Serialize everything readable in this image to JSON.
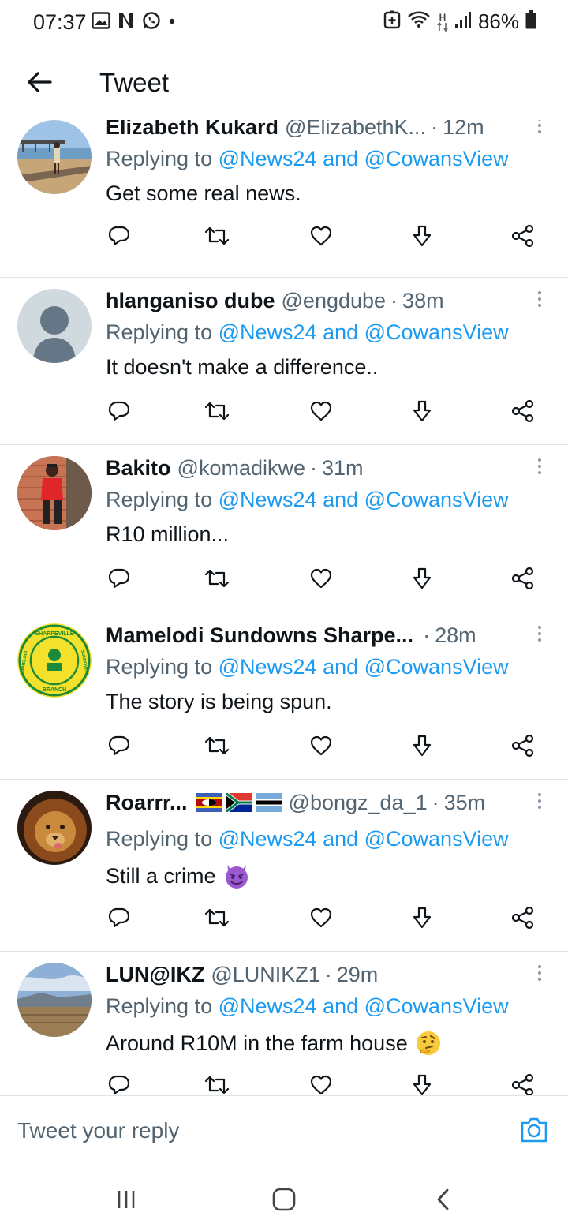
{
  "status_bar": {
    "time": "07:37",
    "battery_percent": "86%",
    "network_label": "H",
    "left_icons": [
      "gallery-icon",
      "netflix-icon",
      "whatsapp-icon",
      "dot-icon"
    ],
    "right_icons": [
      "battery-saver-icon",
      "wifi-icon",
      "data-arrows-icon",
      "signal-icon",
      "battery-icon"
    ]
  },
  "header": {
    "title": "Tweet"
  },
  "tweets": [
    {
      "name": "Elizabeth Kukard",
      "handle": "@ElizabethK...",
      "time": "12m",
      "replying_prefix": "Replying to",
      "replying_to": "@News24 and @CowansView",
      "text": "Get some real news.",
      "avatar": "beach-pier-photo"
    },
    {
      "name": "hlanganiso dube",
      "handle": "@engdube",
      "time": "38m",
      "replying_prefix": "Replying to",
      "replying_to": "@News24 and @CowansView",
      "text": "It doesn't make a difference..",
      "avatar": "default-profile"
    },
    {
      "name": "Bakito",
      "handle": "@komadikwe",
      "time": "31m",
      "replying_prefix": "Replying to",
      "replying_to": "@News24 and @CowansView",
      "text": "R10 million...",
      "avatar": "person-red-shirt-photo"
    },
    {
      "name": "Mamelodi Sundowns Sharpe...",
      "handle": "",
      "time": "28m",
      "replying_prefix": "Replying to",
      "replying_to": "@News24 and @CowansView",
      "text": "The story is being spun.",
      "avatar": "sundowns-badge",
      "avatar_text": {
        "top": "SHARPEVILLE",
        "left": "MAMELODI",
        "right": "SUNDOWNS",
        "bottom": "BRANCH"
      }
    },
    {
      "name": "Roarrr...",
      "handle": "@bongz_da_1",
      "time": "35m",
      "replying_prefix": "Replying to",
      "replying_to": "@News24 and @CowansView",
      "text": "Still a crime",
      "text_emoji": "smiling-devil-emoji",
      "name_flags": [
        "eswatini-flag",
        "south-africa-flag",
        "botswana-flag"
      ],
      "avatar": "lion-photo"
    },
    {
      "name": "LUN@IKZ",
      "handle": "@LUNIKZ1",
      "time": "29m",
      "replying_prefix": "Replying to",
      "replying_to": "@News24 and @CowansView",
      "text": "Around R10M in the farm house",
      "text_emoji": "thinking-face-emoji",
      "avatar": "landscape-photo"
    }
  ],
  "reply_box": {
    "placeholder": "Tweet your reply"
  },
  "colors": {
    "link": "#1d9bf0",
    "secondary_text": "#536471",
    "primary_text": "#0f1419",
    "divider": "#dfe3e6"
  }
}
